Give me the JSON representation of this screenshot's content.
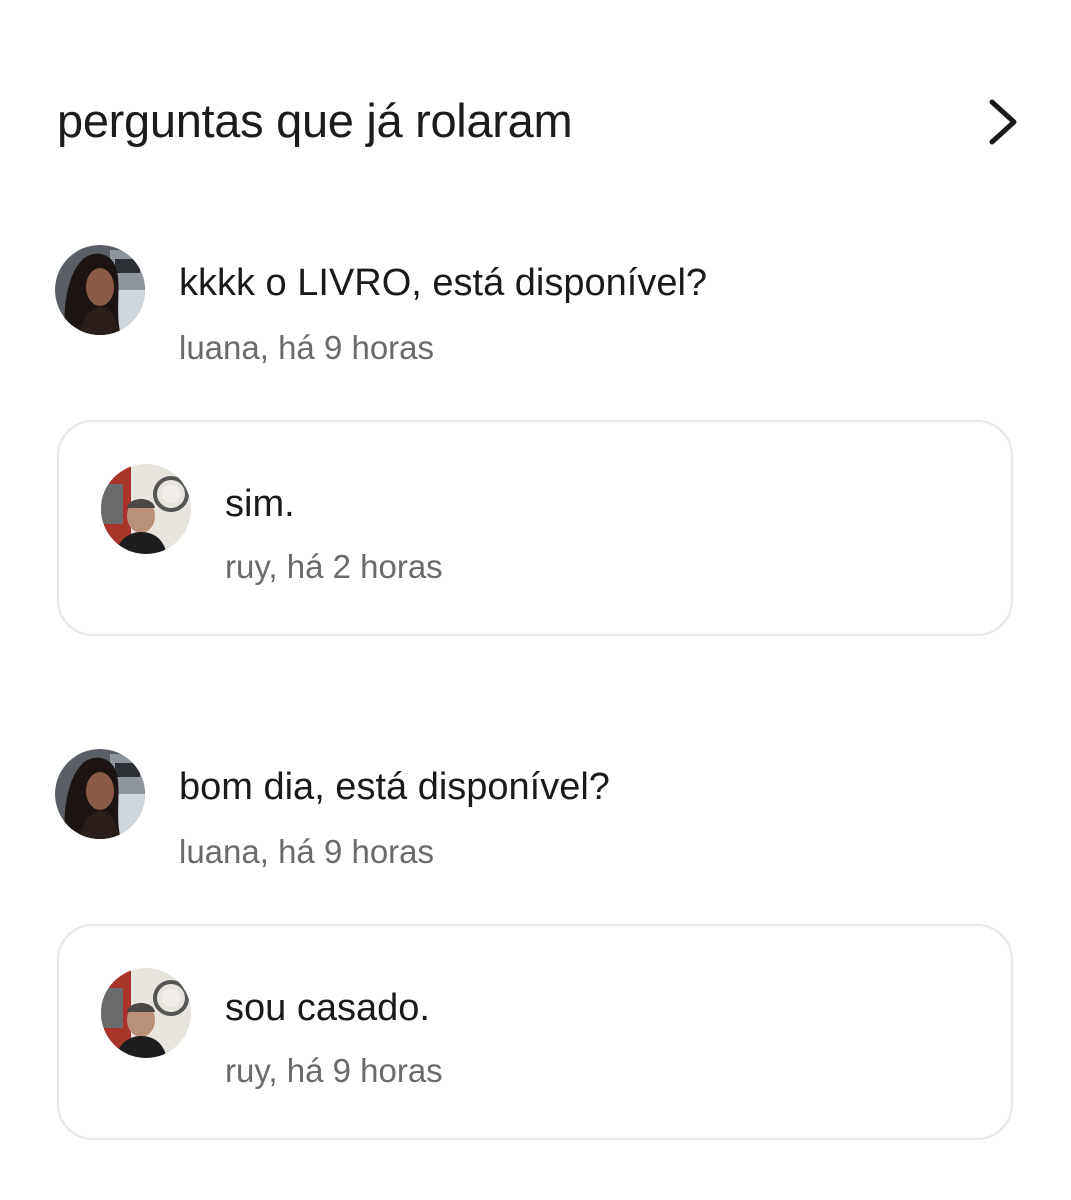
{
  "header": {
    "title": "perguntas que já rolaram",
    "chevron_icon": "chevron-right-icon"
  },
  "threads": [
    {
      "question": {
        "text": "kkkk o LIVRO, está disponível?",
        "meta": "luana, há 9 horas"
      },
      "answer": {
        "text": "sim.",
        "meta": "ruy, há 2 horas"
      }
    },
    {
      "question": {
        "text": "bom dia, está disponível?",
        "meta": "luana, há 9 horas"
      },
      "answer": {
        "text": "sou casado.",
        "meta": "ruy, há 9 horas"
      }
    }
  ],
  "colors": {
    "text": "#1a1a1a",
    "meta": "#6a6a6a",
    "card_border": "#e6e6e6"
  }
}
